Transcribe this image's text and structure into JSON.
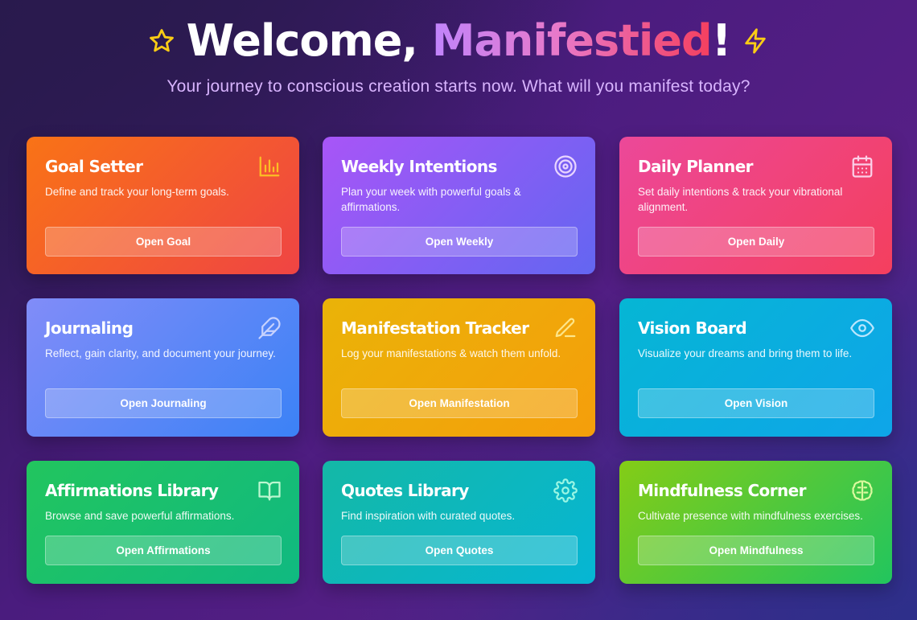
{
  "header": {
    "title_prefix": "Welcome, ",
    "user_name": "Manifestied",
    "title_suffix": "!",
    "subtitle": "Your journey to conscious creation starts now. What will you manifest today?",
    "left_icon": "star-icon",
    "right_icon": "lightning-icon"
  },
  "cards": [
    {
      "title": "Goal Setter",
      "description": "Define and track your long-term goals.",
      "button": "Open Goal",
      "icon": "bar-chart-icon",
      "icon_color": "#fbbf24"
    },
    {
      "title": "Weekly Intentions",
      "description": "Plan your week with powerful goals & affirmations.",
      "button": "Open Weekly",
      "icon": "target-icon",
      "icon_color": "#e9d5ff"
    },
    {
      "title": "Daily Planner",
      "description": "Set daily intentions & track your vibrational alignment.",
      "button": "Open Daily",
      "icon": "calendar-icon",
      "icon_color": "#fbcfe8"
    },
    {
      "title": "Journaling",
      "description": "Reflect, gain clarity, and document your journey.",
      "button": "Open Journaling",
      "icon": "feather-icon",
      "icon_color": "#c7d2fe"
    },
    {
      "title": "Manifestation Tracker",
      "description": "Log your manifestations & watch them unfold.",
      "button": "Open Manifestation",
      "icon": "pencil-icon",
      "icon_color": "#fde68a"
    },
    {
      "title": "Vision Board",
      "description": "Visualize your dreams and bring them to life.",
      "button": "Open Vision",
      "icon": "eye-icon",
      "icon_color": "#bae6fd"
    },
    {
      "title": "Affirmations Library",
      "description": "Browse and save powerful affirmations.",
      "button": "Open Affirmations",
      "icon": "book-icon",
      "icon_color": "#bbf7d0"
    },
    {
      "title": "Quotes Library",
      "description": "Find inspiration with curated quotes.",
      "button": "Open Quotes",
      "icon": "gear-icon",
      "icon_color": "#99f6e4"
    },
    {
      "title": "Mindfulness Corner",
      "description": "Cultivate presence with mindfulness exercises.",
      "button": "Open Mindfulness",
      "icon": "brain-icon",
      "icon_color": "#d9f99d"
    }
  ],
  "colors": {
    "star": "#facc15",
    "lightning": "#facc15",
    "subtitle": "#d8b4fe"
  }
}
